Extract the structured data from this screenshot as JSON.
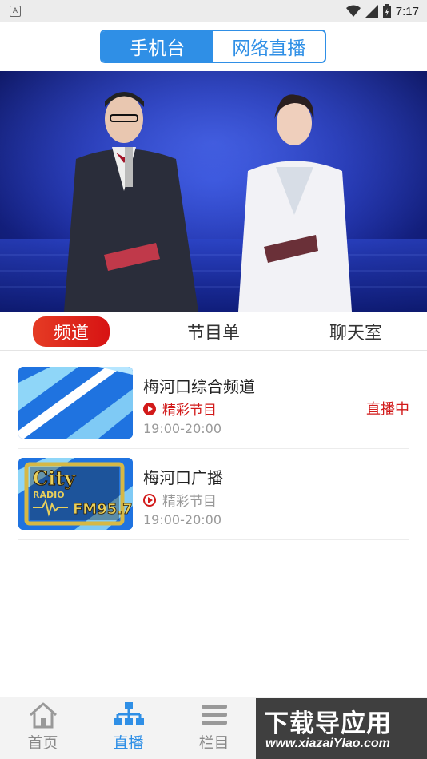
{
  "status_bar": {
    "app_badge": "A",
    "time": "7:17",
    "icons": [
      "wifi-icon",
      "signal-icon",
      "battery-icon"
    ]
  },
  "segment": {
    "options": [
      "手机台",
      "网络直播"
    ],
    "selected": "手机台"
  },
  "hero": {
    "description_icon": "video-player"
  },
  "tabs": {
    "items": [
      "频道",
      "节目单",
      "聊天室"
    ],
    "selected": "频道"
  },
  "channels": [
    {
      "name": "梅河口综合频道",
      "program": "精彩节目",
      "time": "19:00-20:00",
      "status": "直播中",
      "thumb_icon": "tv-channel-logo"
    },
    {
      "name": "梅河口广播",
      "program": "精彩节目",
      "time": "19:00-20:00",
      "status": "",
      "thumb_icon": "city-radio-fm957-logo",
      "thumb_logo_text": "City RADIO FM95.7"
    }
  ],
  "bottom_nav": {
    "items": [
      {
        "label": "首页",
        "icon": "home-icon"
      },
      {
        "label": "直播",
        "icon": "live-tree-icon"
      },
      {
        "label": "栏目",
        "icon": "menu-icon"
      }
    ],
    "selected": "直播"
  },
  "watermark": {
    "title": "下载导应用",
    "url": "www.xiazaiYIao.com"
  },
  "colors": {
    "accent_blue": "#2f8fe6",
    "accent_red": "#d21a1a",
    "status_bar_bg": "#ececec"
  }
}
